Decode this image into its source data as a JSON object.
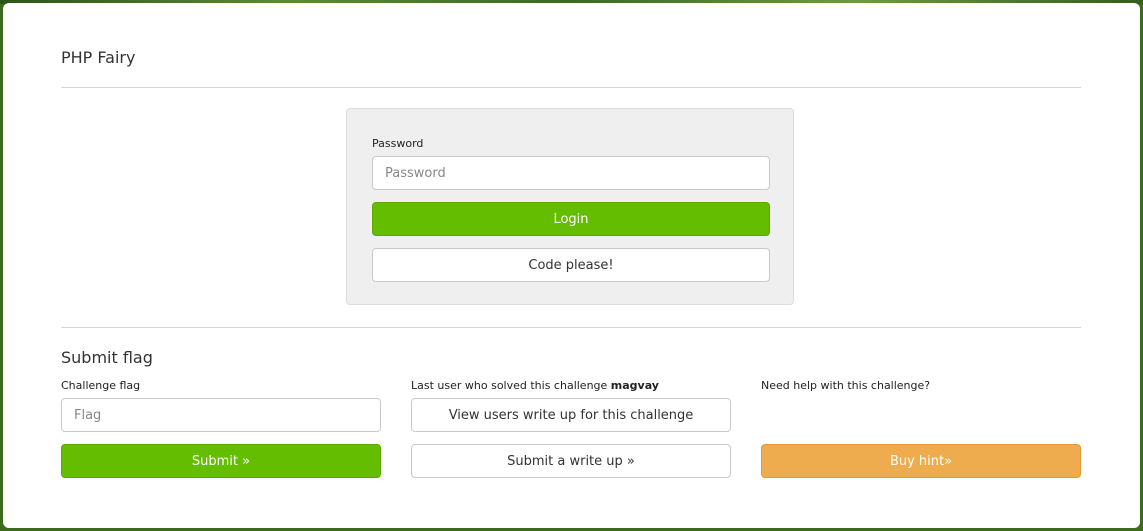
{
  "page": {
    "title": "PHP Fairy"
  },
  "login": {
    "password_label": "Password",
    "password_placeholder": "Password",
    "password_value": "",
    "login_button": "Login",
    "code_button": "Code please!"
  },
  "flag_section": {
    "title": "Submit flag",
    "flag_label": "Challenge flag",
    "flag_placeholder": "Flag",
    "flag_value": "",
    "submit_button": "Submit »",
    "last_user_prefix": "Last user who solved this challenge ",
    "last_user_name": "magvay",
    "view_writeup_button": "View users write up for this challenge",
    "submit_writeup_button": "Submit a write up »",
    "help_label": "Need help with this challenge?",
    "hint_button": "Buy hint»"
  },
  "colors": {
    "primary_green": "#65bd00",
    "hint_orange": "#eeac4e",
    "background_green": "#3d6b1e"
  }
}
